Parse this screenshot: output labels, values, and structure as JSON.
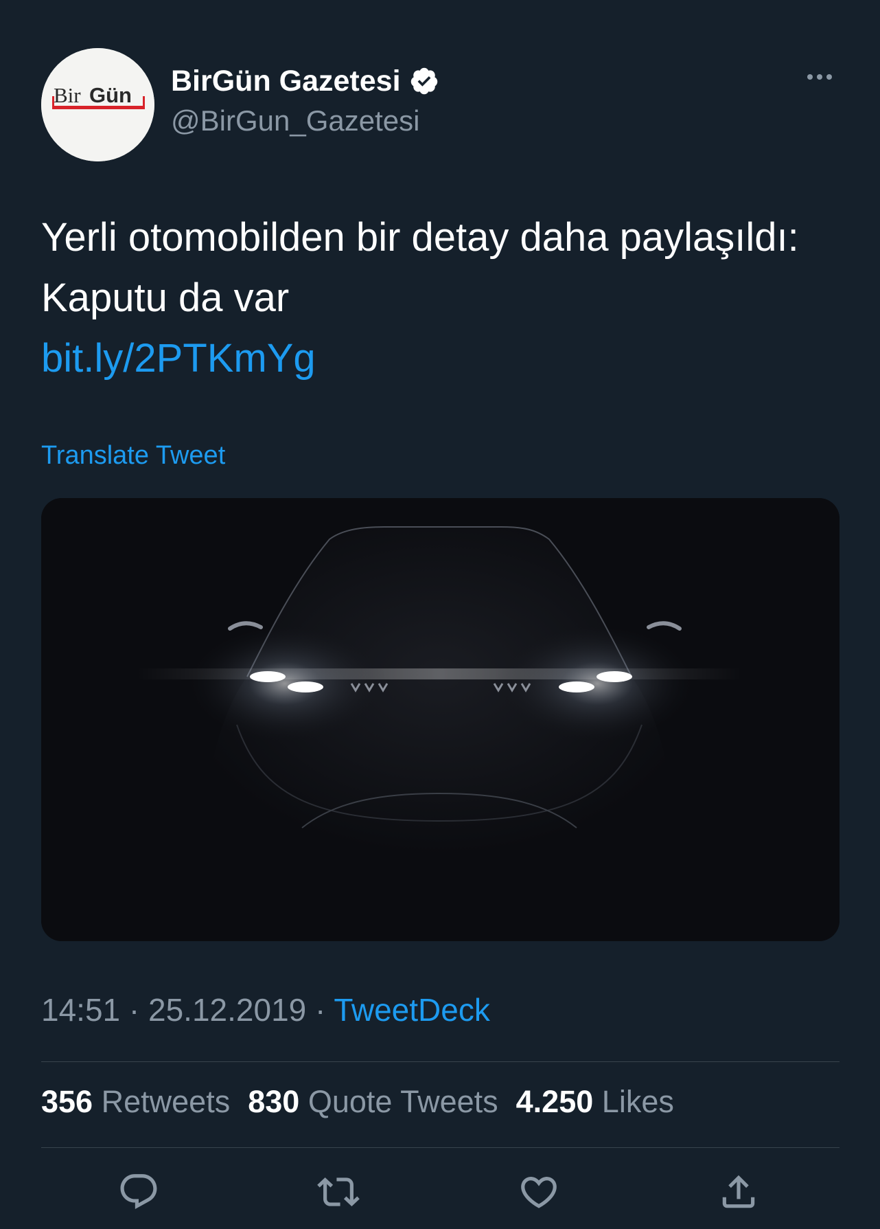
{
  "account": {
    "display_name": "BirGün Gazetesi",
    "handle": "@BirGun_Gazetesi",
    "avatar_text_light": "Bir",
    "avatar_text_bold": "Gün",
    "verified": true
  },
  "tweet": {
    "text": "Yerli otomobilden bir detay daha paylaşıldı: Kaputu da var",
    "link": "bit.ly/2PTKmYg",
    "translate_label": "Translate Tweet",
    "image_description_icon": "car-headlights-image"
  },
  "meta": {
    "time": "14:51",
    "separator": "·",
    "date": "25.12.2019",
    "source": "TweetDeck"
  },
  "stats": {
    "retweets_count": "356",
    "retweets_label": "Retweets",
    "quotes_count": "830",
    "quotes_label": "Quote Tweets",
    "likes_count": "4.250",
    "likes_label": "Likes"
  },
  "actions": {
    "reply_icon": "reply-icon",
    "retweet_icon": "retweet-icon",
    "like_icon": "heart-icon",
    "share_icon": "share-icon"
  },
  "colors": {
    "background": "#15202b",
    "accent": "#1d9bf0",
    "secondary_text": "#8b98a5",
    "divider": "#38444d"
  }
}
